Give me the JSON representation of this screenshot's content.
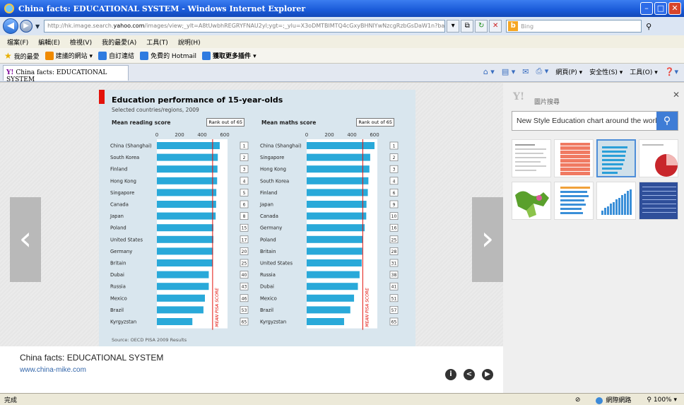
{
  "window": {
    "title": "China facts: EDUCATIONAL SYSTEM - Windows Internet Explorer",
    "min_glyph": "–",
    "max_glyph": "□",
    "close_glyph": "✕"
  },
  "address": {
    "url_prefix": "http://hk.image.search.",
    "url_host": "yahoo.com",
    "url_rest": "/images/view;_ylt=A8tUwbhREGRYFNAU2yl;ygt=;_ylu=X3oDMTBlMTQ4cGxyBHNlYwNzcgRzbGsDaW1n?back",
    "bing_placeholder": "Bing"
  },
  "menubar": [
    "檔案(F)",
    "編輯(E)",
    "檢視(V)",
    "我的最愛(A)",
    "工具(T)",
    "說明(H)"
  ],
  "favbar": {
    "favorites": "我的最愛",
    "suggested": "建議的網站 ▾",
    "custom_links": "自訂連結",
    "hotmail": "免費的 Hotmail",
    "more_addons": "獲取更多插件 ▾"
  },
  "tab": {
    "label": "China facts: EDUCATIONAL SYSTEM"
  },
  "commandbar": {
    "page": "網頁(P) ▾",
    "safety": "安全性(S) ▾",
    "tools": "工具(O) ▾"
  },
  "chart_data": [
    {
      "type": "bar",
      "title": "Education performance of 15-year-olds",
      "subtitle": "Selected countries/regions, 2009",
      "panel_title": "Mean reading score",
      "rank_header": "Rank out of 65",
      "xlim": [
        0,
        600
      ],
      "ticks": [
        0,
        200,
        400,
        600
      ],
      "mean_line": 493,
      "mean_label": "MEAN PISA SCORE",
      "categories": [
        "China (Shanghai)",
        "South Korea",
        "Finland",
        "Hong Kong",
        "Singapore",
        "Canada",
        "Japan",
        "Poland",
        "United States",
        "Germany",
        "Britain",
        "Dubai",
        "Russia",
        "Mexico",
        "Brazil",
        "Kyrgyzstan"
      ],
      "values": [
        556,
        539,
        536,
        533,
        526,
        524,
        520,
        500,
        500,
        497,
        494,
        459,
        459,
        425,
        412,
        314
      ],
      "ranks": [
        "1",
        "2",
        "3",
        "4",
        "5",
        "6",
        "8",
        "15",
        "17",
        "20",
        "25",
        "40",
        "43",
        "46",
        "53",
        "65"
      ]
    },
    {
      "type": "bar",
      "panel_title": "Mean maths score",
      "rank_header": "Rank out of 65",
      "xlim": [
        0,
        600
      ],
      "ticks": [
        0,
        200,
        400,
        600
      ],
      "mean_line": 496,
      "mean_label": "MEAN PISA SCORE",
      "categories": [
        "China (Shanghai)",
        "Singapore",
        "Hong Kong",
        "South Korea",
        "Finland",
        "Japan",
        "Canada",
        "Germany",
        "Poland",
        "Britain",
        "United States",
        "Russia",
        "Dubai",
        "Mexico",
        "Brazil",
        "Kyrgyzstan"
      ],
      "values": [
        600,
        562,
        555,
        546,
        541,
        529,
        527,
        513,
        495,
        492,
        487,
        468,
        453,
        419,
        386,
        331
      ],
      "ranks": [
        "1",
        "2",
        "3",
        "4",
        "6",
        "9",
        "10",
        "16",
        "25",
        "28",
        "31",
        "38",
        "41",
        "51",
        "57",
        "65"
      ]
    }
  ],
  "chart_source": "Source: OECD PISA 2009 Results",
  "caption": {
    "title": "China facts: EDUCATIONAL SYSTEM",
    "link": "www.china-mike.com"
  },
  "sidepanel": {
    "logo": "Y!",
    "label": "圖片搜尋",
    "query": "New Style Education chart around the world"
  },
  "statusbar": {
    "status": "完成",
    "zone": "網際網路",
    "zoom": "100%"
  }
}
